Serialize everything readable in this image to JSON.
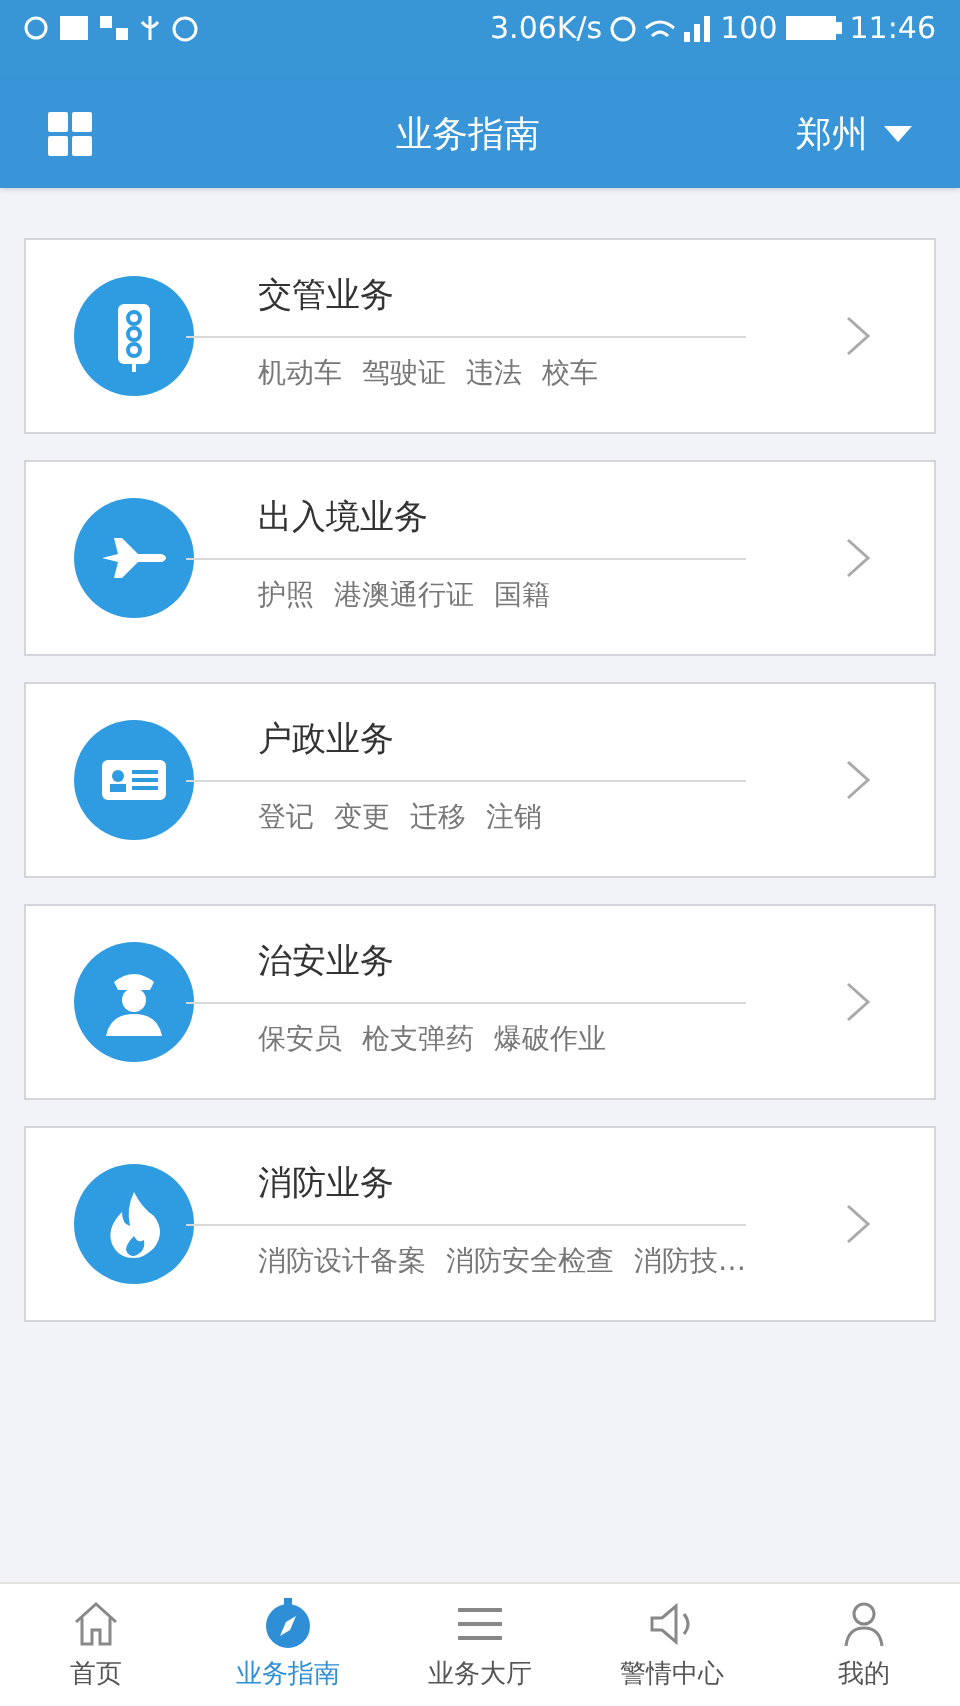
{
  "status_bar": {
    "speed": "3.06K/s",
    "battery": "100",
    "time": "11:46"
  },
  "header": {
    "title": "业务指南",
    "city": "郑州"
  },
  "services": [
    {
      "kind": "traffic",
      "title": "交管业务",
      "tags": [
        "机动车",
        "驾驶证",
        "违法",
        "校车"
      ]
    },
    {
      "kind": "plane",
      "title": "出入境业务",
      "tags": [
        "护照",
        "港澳通行证",
        "国籍"
      ]
    },
    {
      "kind": "card",
      "title": "户政业务",
      "tags": [
        "登记",
        "变更",
        "迁移",
        "注销"
      ]
    },
    {
      "kind": "police",
      "title": "治安业务",
      "tags": [
        "保安员",
        "枪支弹药",
        "爆破作业"
      ]
    },
    {
      "kind": "fire",
      "title": "消防业务",
      "tags": [
        "消防设计备案",
        "消防安全检查",
        "消防技…"
      ]
    }
  ],
  "tabs": [
    {
      "kind": "home",
      "label": "首页",
      "selected": false
    },
    {
      "kind": "compass",
      "label": "业务指南",
      "selected": true
    },
    {
      "kind": "list",
      "label": "业务大厅",
      "selected": false
    },
    {
      "kind": "speaker",
      "label": "警情中心",
      "selected": false
    },
    {
      "kind": "person",
      "label": "我的",
      "selected": false
    }
  ]
}
